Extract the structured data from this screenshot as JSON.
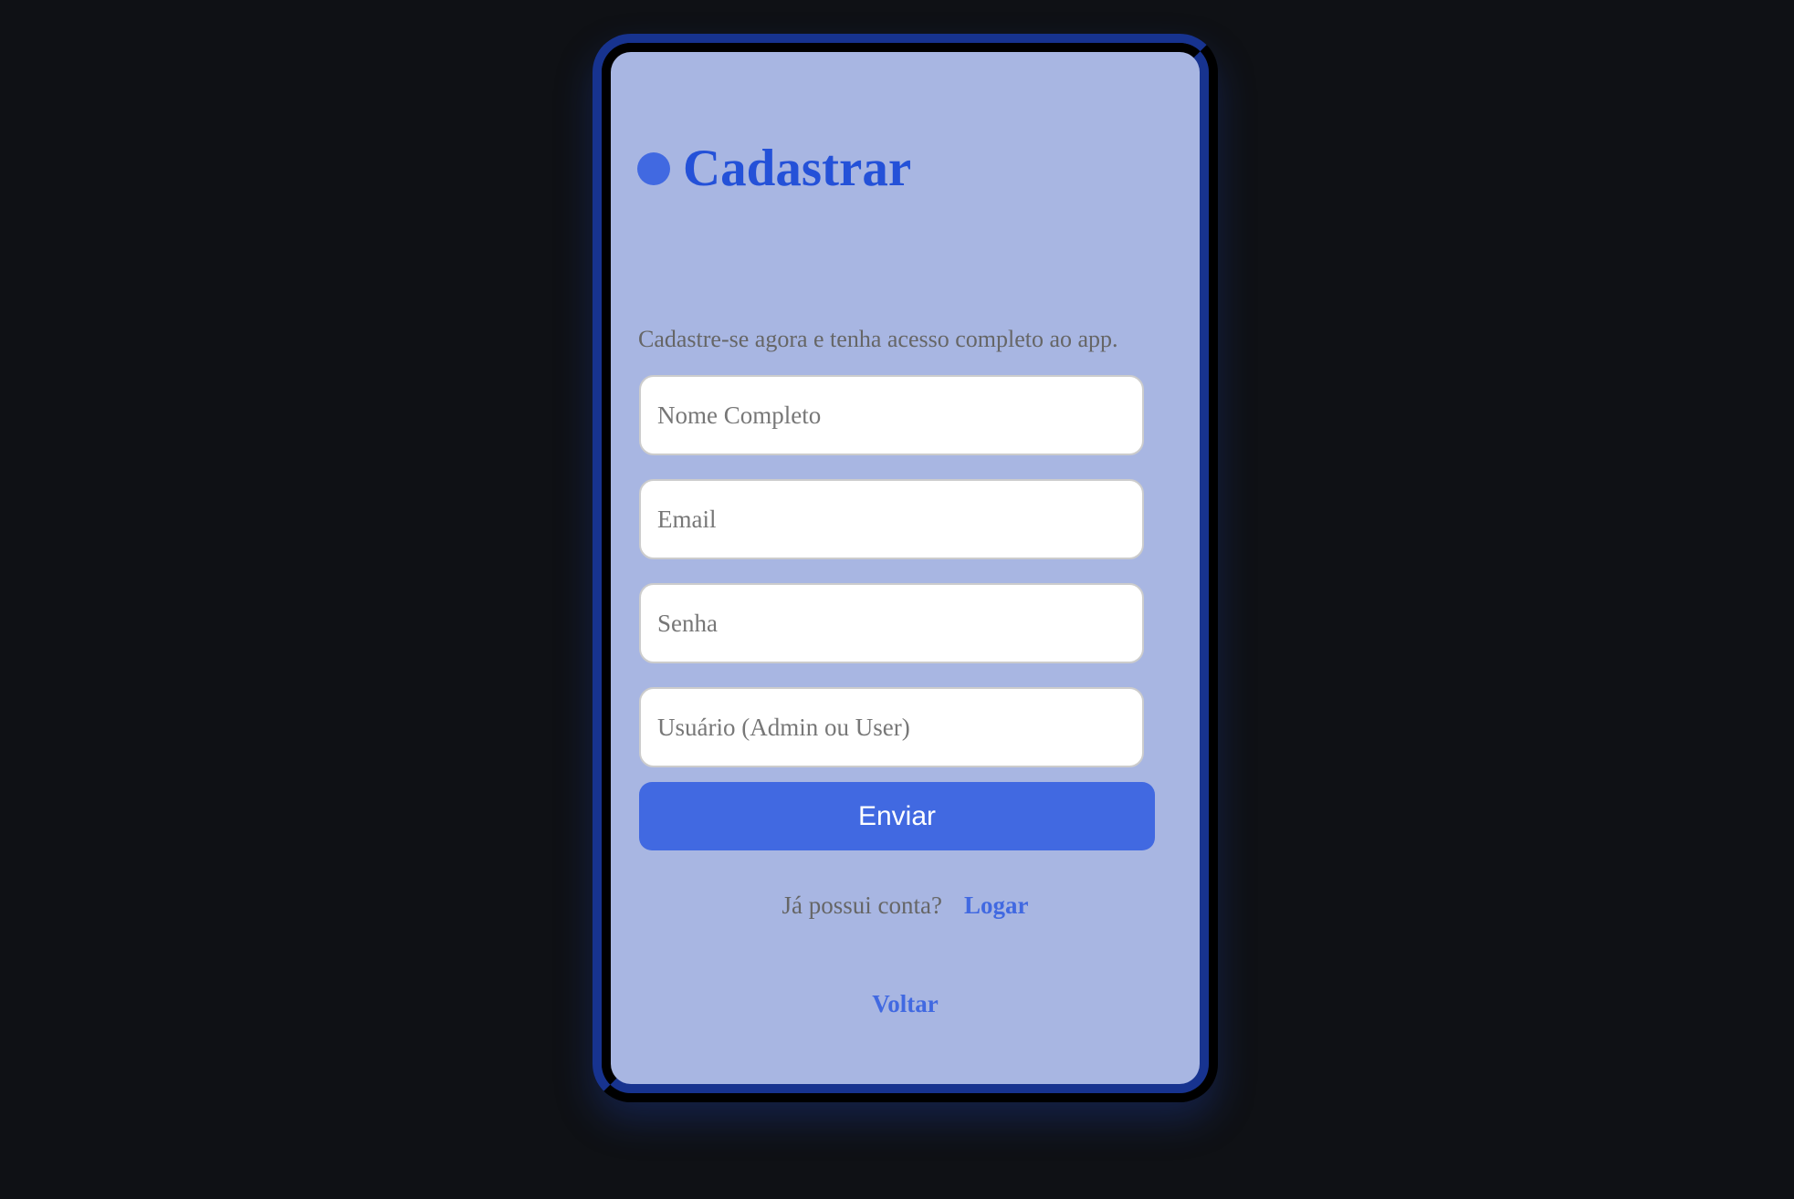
{
  "header": {
    "title": "Cadastrar",
    "logo_icon": "circle-dot-icon"
  },
  "subtitle": "Cadastre-se agora e tenha acesso completo ao app.",
  "form": {
    "fields": [
      {
        "placeholder": "Nome Completo",
        "value": ""
      },
      {
        "placeholder": "Email",
        "value": ""
      },
      {
        "placeholder": "Senha",
        "value": ""
      },
      {
        "placeholder": "Usuário (Admin ou User)",
        "value": ""
      }
    ],
    "submit_label": "Enviar"
  },
  "login_prompt": {
    "text": "Já possui conta?",
    "link": "Logar"
  },
  "back_link": "Voltar",
  "colors": {
    "accent": "#4169e1",
    "panel": "#a8b6e2",
    "frame": "#17338f",
    "background": "#0f1115"
  }
}
